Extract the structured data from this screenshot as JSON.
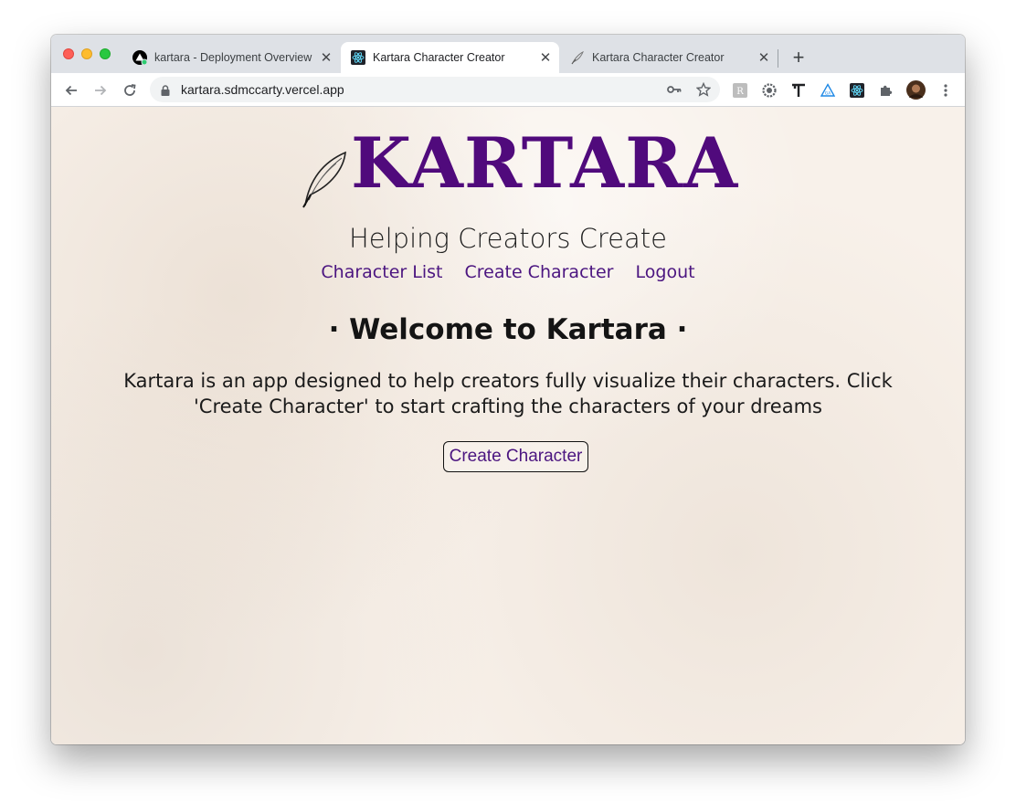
{
  "browser": {
    "tabs": [
      {
        "title": "kartara - Deployment Overview",
        "icon": "vercel-icon",
        "active": false
      },
      {
        "title": "Kartara Character Creator",
        "icon": "react-icon",
        "active": true
      },
      {
        "title": "Kartara Character Creator",
        "icon": "quill-icon",
        "active": false
      }
    ],
    "new_tab_label": "+",
    "url": "kartara.sdmccarty.vercel.app",
    "extensions": [
      "readability-icon",
      "gear-extension-icon",
      "typography-icon",
      "triangle-extension-icon",
      "react-devtools-icon",
      "puzzle-icon",
      "avatar"
    ]
  },
  "page": {
    "logo_text": "KARTARA",
    "tagline": "Helping Creators Create",
    "nav": {
      "character_list": "Character List",
      "create_character": "Create Character",
      "logout": "Logout"
    },
    "welcome_heading": "· Welcome to Kartara ·",
    "description": "Kartara is an app designed to help creators fully visualize their characters. Click 'Create Character' to start crafting the characters of your dreams",
    "cta_label": "Create Character"
  },
  "colors": {
    "brand_purple": "#500a7c",
    "link_purple": "#4b1580",
    "page_bg": "#f8f1ea"
  }
}
